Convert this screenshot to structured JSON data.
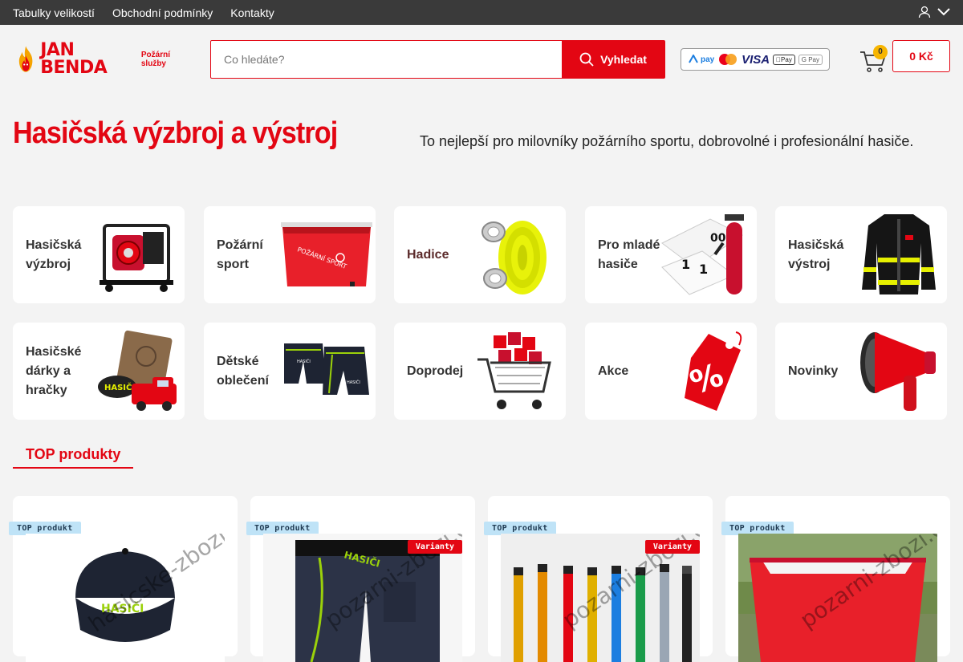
{
  "topbar": {
    "links": [
      "Tabulky velikostí",
      "Obchodní podmínky",
      "Kontakty"
    ]
  },
  "header": {
    "logo_name": "JAN BENDA",
    "logo_sub_1": "Požární",
    "logo_sub_2": "služby",
    "search_placeholder": "Co hledáte?",
    "search_button": "Vyhledat",
    "payments": {
      "visa": "VISA",
      "apple": "Pay",
      "gpay": "G Pay",
      "twisto": "pay"
    },
    "cart_count": "0",
    "cart_total": "0 Kč"
  },
  "hero": {
    "title": "Hasičská výzbroj a výstroj",
    "subtitle": "To nejlepší pro milovníky požárního sportu, dobrovolné i profesionální hasiče."
  },
  "categories": [
    {
      "label": "Hasičská výzbroj",
      "icon": "fire-pump-icon"
    },
    {
      "label": "Požární sport",
      "icon": "water-tank-icon"
    },
    {
      "label": "Hadice",
      "icon": "fire-hose-icon"
    },
    {
      "label": "Pro mladé hasiče",
      "icon": "extinguisher-icon"
    },
    {
      "label": "Hasičská výstroj",
      "icon": "fire-jacket-icon"
    },
    {
      "label": "Hasičské dárky a hračky",
      "icon": "gift-toys-icon"
    },
    {
      "label": "Dětské oblečení",
      "icon": "kids-shorts-icon"
    },
    {
      "label": "Doprodej",
      "icon": "shopping-cart-sale-icon"
    },
    {
      "label": "Akce",
      "icon": "percent-tag-icon"
    },
    {
      "label": "Novinky",
      "icon": "megaphone-icon"
    }
  ],
  "top_products": {
    "heading": "TOP produkty",
    "items": [
      {
        "badge": "TOP produkt",
        "variant": "",
        "watermark": "hasicske-zbozi.cz",
        "image": "cap-icon"
      },
      {
        "badge": "TOP produkt",
        "variant": "Varianty",
        "watermark": "pozarni-zbozi.cz",
        "image": "pants-icon"
      },
      {
        "badge": "TOP produkt",
        "variant": "Varianty",
        "watermark": "pozarni-zbozi.cz",
        "image": "batons-icon"
      },
      {
        "badge": "TOP produkt",
        "variant": "",
        "watermark": "pozarni-zbozi.cz",
        "image": "red-tank-icon"
      }
    ]
  },
  "colors": {
    "brand_red": "#e30613",
    "topbar": "#3a3a3a",
    "badge_blue": "#bfe3f7",
    "cart_badge": "#f7b500"
  }
}
